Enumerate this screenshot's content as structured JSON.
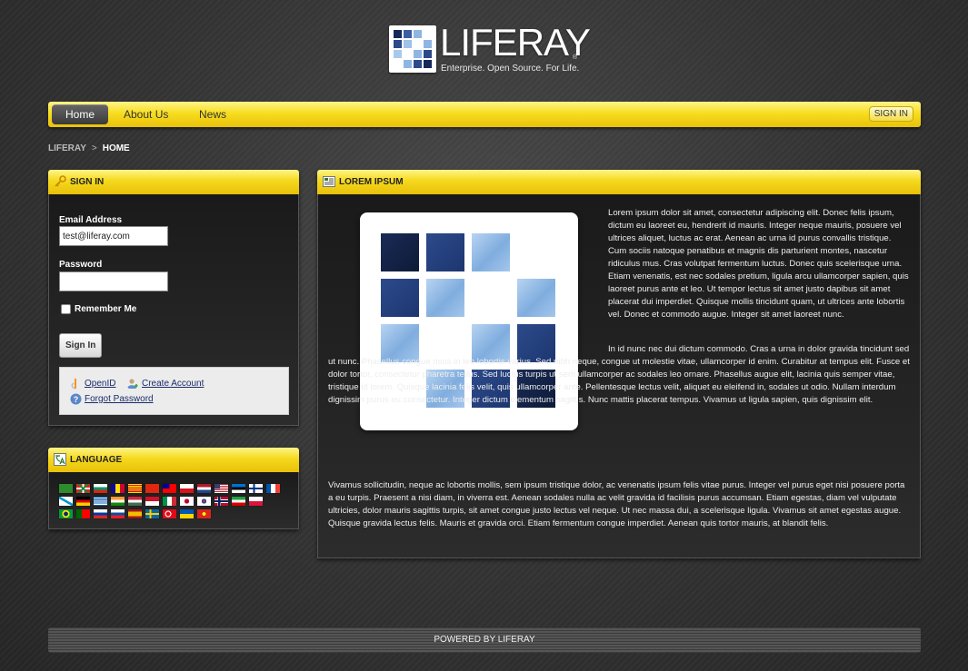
{
  "logo": {
    "word": "LIFERAY",
    "tagline": "Enterprise. Open Source. For Life.",
    "reg": "®"
  },
  "nav": {
    "items": [
      "Home",
      "About Us",
      "News"
    ],
    "signin": "SIGN IN"
  },
  "breadcrumb": {
    "root": "LIFERAY",
    "sep": ">",
    "current": "HOME"
  },
  "signin_portlet": {
    "title": "SIGN IN",
    "email_label": "Email Address",
    "email_value": "test@liferay.com",
    "password_label": "Password",
    "remember_label": "Remember Me",
    "button": "Sign In",
    "openid": "OpenID",
    "create_account": "Create Account",
    "forgot_password": "Forgot Password"
  },
  "language_portlet": {
    "title": "LANGUAGE",
    "flags": [
      [
        "saudi-arabia",
        "basque",
        "bulgaria",
        "andorra",
        "catalonia",
        "china",
        "taiwan",
        "czech",
        "netherlands",
        "usa",
        "estonia",
        "finland",
        "france"
      ],
      [
        "galicia",
        "germany",
        "greece",
        "india",
        "hungary",
        "indonesia",
        "italy",
        "japan",
        "korea",
        "norway",
        "iran",
        "poland"
      ],
      [
        "brazil",
        "portugal",
        "russia",
        "slovakia",
        "spain",
        "sweden",
        "turkey",
        "ukraine",
        "vietnam"
      ]
    ]
  },
  "content_portlet": {
    "title": "LOREM IPSUM",
    "p1": "Lorem ipsum dolor sit amet, consectetur adipiscing elit. Donec felis ipsum, dictum eu laoreet eu, hendrerit id mauris. Integer neque mauris, posuere vel ultrices aliquet, luctus ac erat. Aenean ac urna id purus convallis tristique. Cum sociis natoque penatibus et magnis dis parturient montes, nascetur ridiculus mus. Cras volutpat fermentum luctus. Donec quis scelerisque urna. Etiam venenatis, est nec sodales pretium, ligula arcu ullamcorper sapien, quis laoreet purus ante et leo. Ut tempor lectus sit amet justo dapibus sit amet placerat dui imperdiet. Quisque mollis tincidunt quam, ut ultrices ante lobortis vel. Donec et commodo augue. Integer sit amet laoreet nunc.",
    "p2": "In id nunc nec dui dictum commodo. Cras a urna in dolor gravida tincidunt sed ut nunc. Phasellus congue risus in leo lobortis varius. Sed nibh neque, congue ut molestie vitae, ullamcorper id enim. Curabitur at tempus elit. Fusce et dolor tortor, consectetur pharetra tellus. Sed luctus turpis ut sem ullamcorper ac sodales leo ornare. Phasellus augue elit, lacinia quis semper vitae, tristique id lorem. Quisque lacinia felis velit, quis ullamcorper ante. Pellentesque lectus velit, aliquet eu eleifend in, sodales ut odio. Nullam interdum dignissim purus eu consectetur. Integer dictum elementum sagittis. Nunc mattis placerat tempus. Vivamus ut ligula sapien, quis dignissim elit.",
    "p3": "Vivamus sollicitudin, neque ac lobortis mollis, sem ipsum tristique dolor, ac venenatis ipsum felis vitae purus. Integer vel purus eget nisi posuere porta a eu turpis. Praesent a nisi diam, in viverra est. Aenean sodales nulla ac velit gravida id facilisis purus accumsan. Etiam egestas, diam vel vulputate ultricies, dolor mauris sagittis turpis, sit amet congue justo lectus vel neque. Ut nec massa dui, a scelerisque ligula. Vivamus sit amet egestas augue. Quisque gravida lectus felis. Mauris et gravida orci. Etiam fermentum congue imperdiet. Aenean quis tortor mauris, at blandit felis."
  },
  "footer": {
    "text": "POWERED BY LIFERAY"
  }
}
